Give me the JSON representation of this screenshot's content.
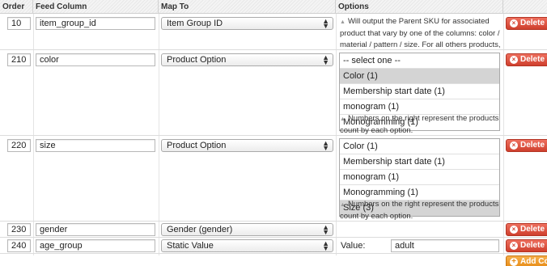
{
  "columns": {
    "order": "Order",
    "feed_column": "Feed Column",
    "map_to": "Map To",
    "options": "Options"
  },
  "rows": [
    {
      "order": "10",
      "feed_column": "item_group_id",
      "map_to": "Item Group ID",
      "note": "Will output the Parent SKU for associated product that vary by one of the columns: color / material / pattern / size. For all others products, it will output empty.",
      "delete_label": "Delete"
    },
    {
      "order": "210",
      "feed_column": "color",
      "map_to": "Product Option",
      "options": [
        "-- select one --",
        "Color (1)",
        "Membership start date (1)",
        "monogram (1)",
        "Monogramming (1)"
      ],
      "selected": "Color (1)",
      "note": "Numbers on the right represent the products count by each option.",
      "delete_label": "Delete"
    },
    {
      "order": "220",
      "feed_column": "size",
      "map_to": "Product Option",
      "options": [
        "Color (1)",
        "Membership start date (1)",
        "monogram (1)",
        "Monogramming (1)",
        "Size (3)"
      ],
      "selected": "Size (3)",
      "note": "Numbers on the right represent the products count by each option.",
      "delete_label": "Delete"
    },
    {
      "order": "230",
      "feed_column": "gender",
      "map_to": "Gender (gender)",
      "delete_label": "Delete"
    },
    {
      "order": "240",
      "feed_column": "age_group",
      "map_to": "Static Value",
      "value_label": "Value:",
      "value": "adult",
      "delete_label": "Delete"
    }
  ],
  "add_button": "Add Column",
  "colors": {
    "delete": "#d24534",
    "add": "#e68a14",
    "highlight": "#d4d4d4"
  }
}
